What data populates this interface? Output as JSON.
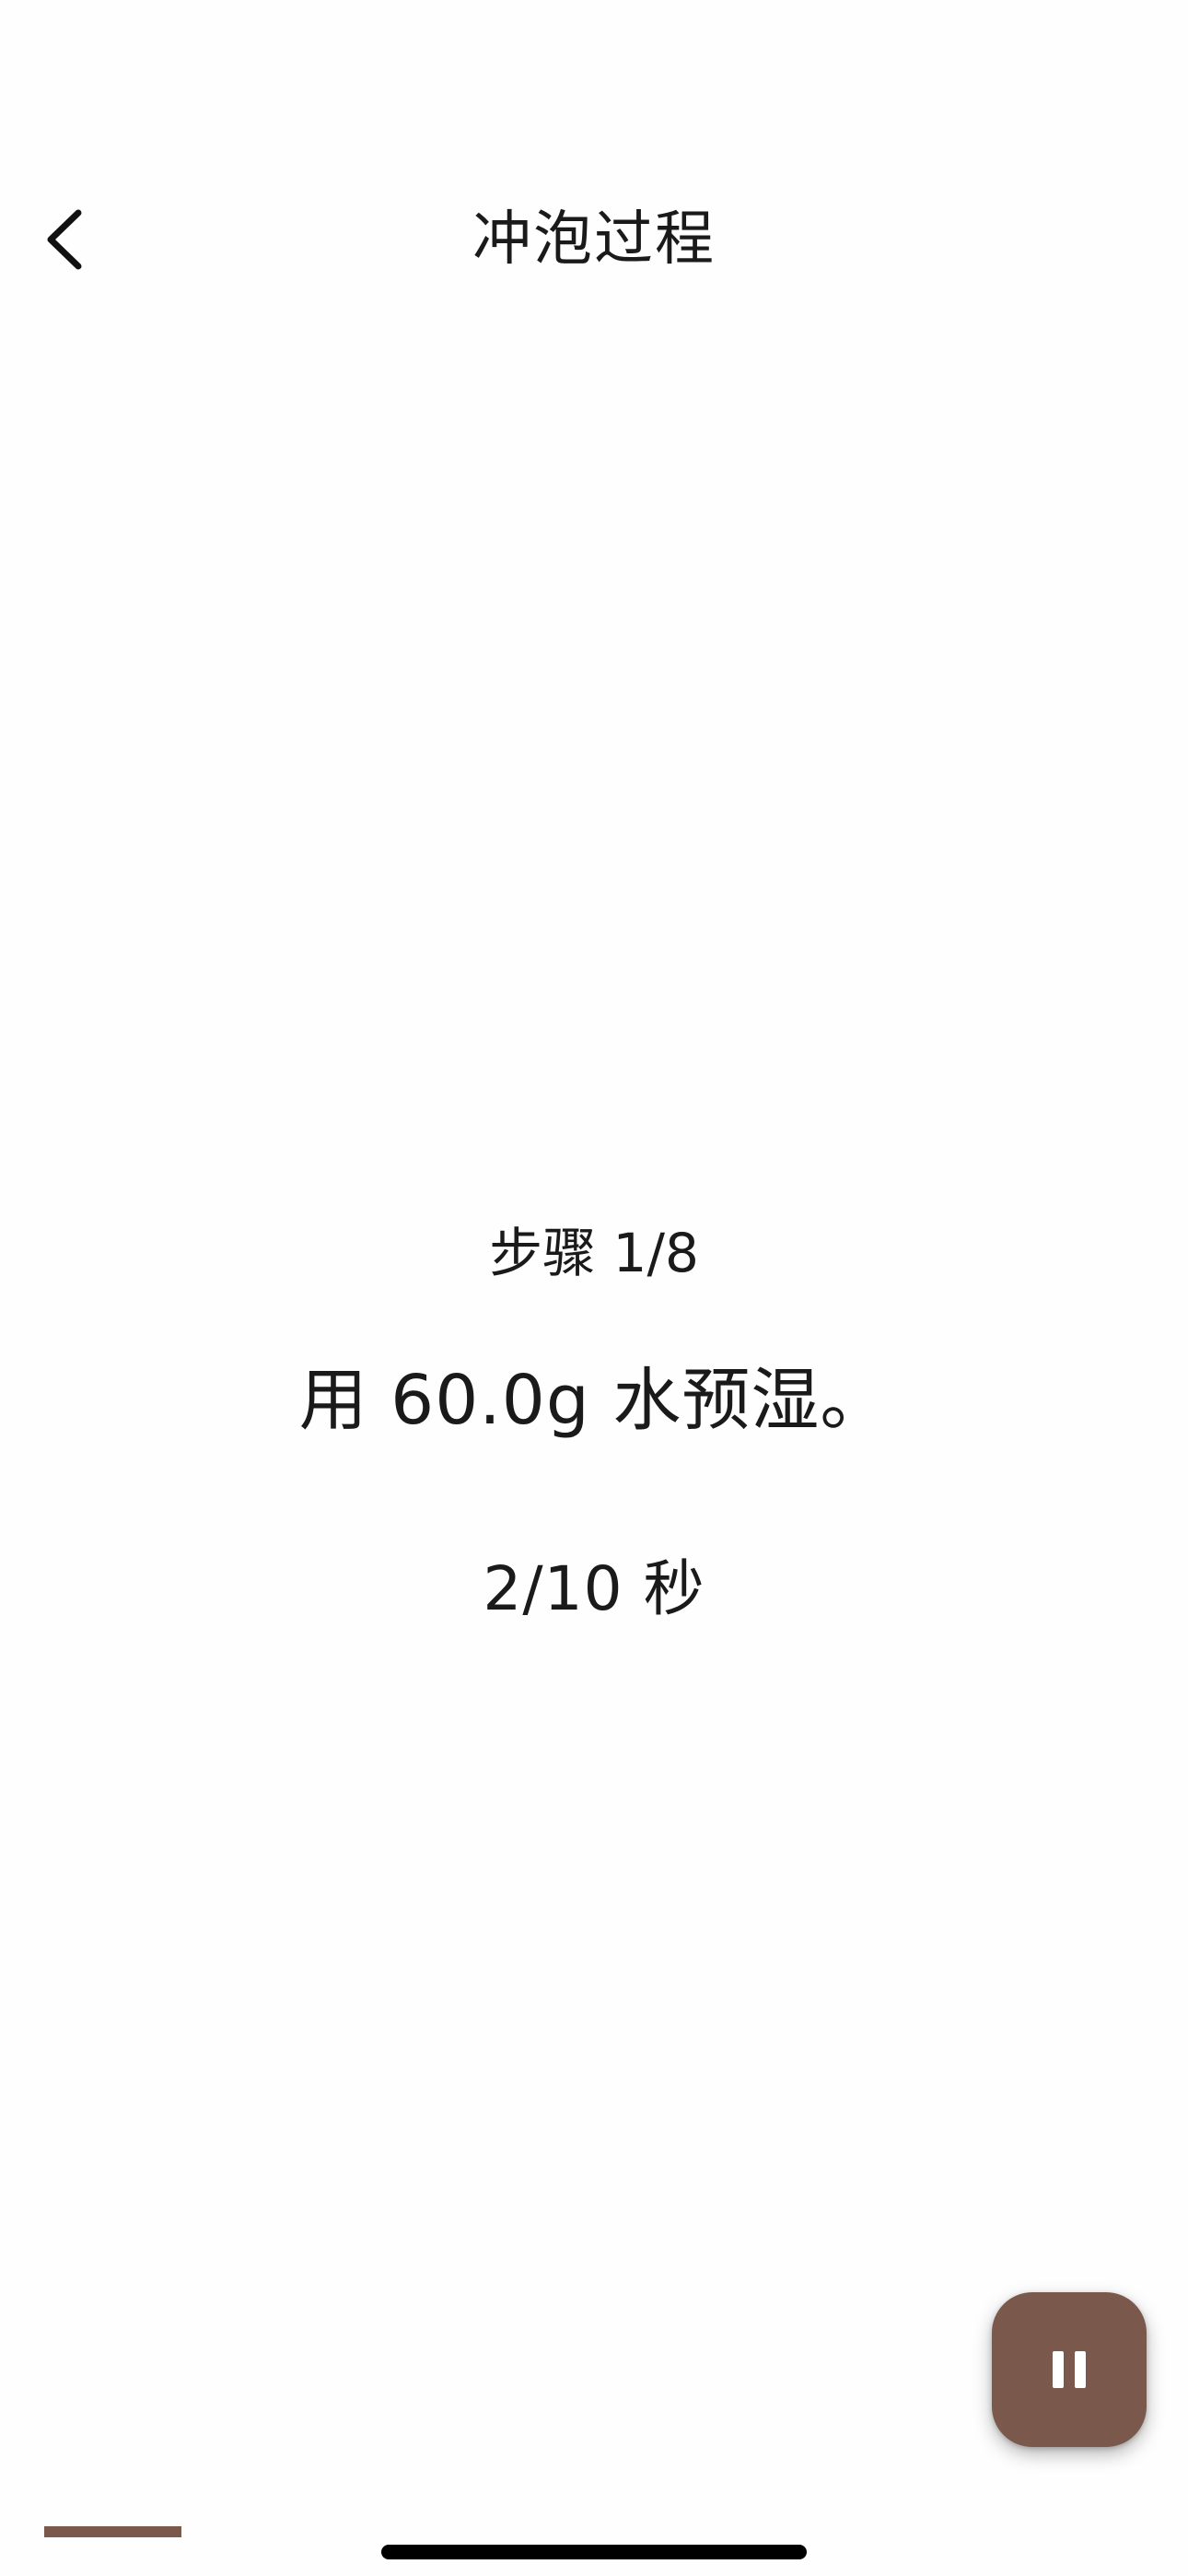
{
  "header": {
    "title": "冲泡过程",
    "back_icon": "chevron-left-icon"
  },
  "step": {
    "label": "步骤 1/8",
    "instruction": "用 60.0g 水预湿。",
    "timer": "2/10 秒"
  },
  "controls": {
    "pause_icon": "pause-icon"
  },
  "progress": {
    "fraction": 0.125
  },
  "colors": {
    "accent": "#7a584b",
    "background": "#fefefe",
    "text": "#1a1a1a"
  }
}
